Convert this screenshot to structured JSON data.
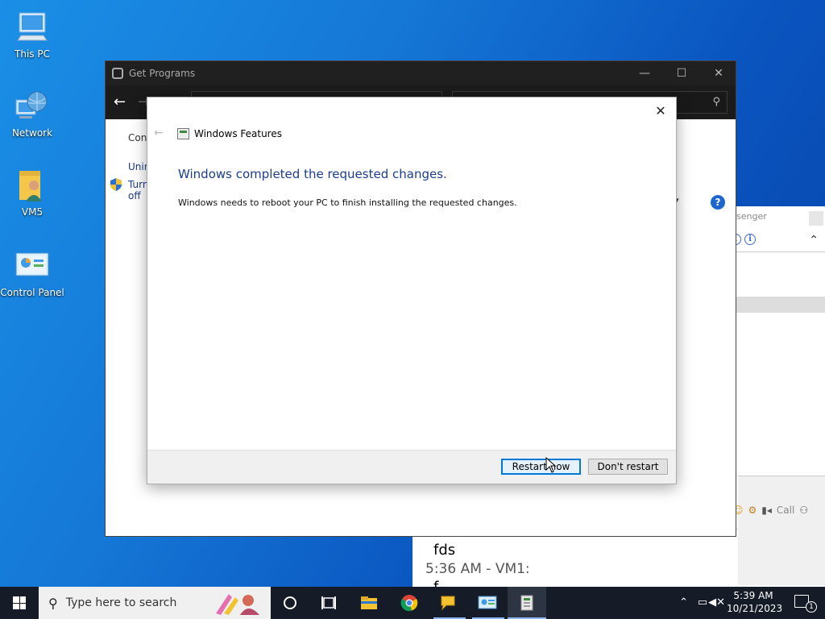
{
  "desktop": {
    "icons": [
      {
        "label": "This PC"
      },
      {
        "label": "Network"
      },
      {
        "label": "VM5"
      },
      {
        "label": "Control Panel"
      }
    ]
  },
  "messenger": {
    "title_fragment": "senger",
    "call_label": "Call",
    "chat": {
      "message1": "fds",
      "meta2": "5:36 AM - VM1:",
      "message2": "f"
    }
  },
  "get_programs": {
    "title": "Get Programs",
    "sidebar": {
      "item1": "Cont",
      "item2": "Unin",
      "item3_line1": "Turn",
      "item3_line2": "off"
    }
  },
  "dialog": {
    "app_title": "Windows Features",
    "heading": "Windows completed the requested changes.",
    "message": "Windows needs to reboot your PC to finish installing the requested changes.",
    "restart_label": "Restart now",
    "dont_restart_label": "Don't restart"
  },
  "taskbar": {
    "search_placeholder": "Type here to search",
    "time": "5:39 AM",
    "date": "10/21/2023",
    "notification_count": "1"
  },
  "colors": {
    "accent": "#0078d7",
    "heading_blue": "#1b3d8f",
    "taskbar_bg": "#151c28"
  }
}
